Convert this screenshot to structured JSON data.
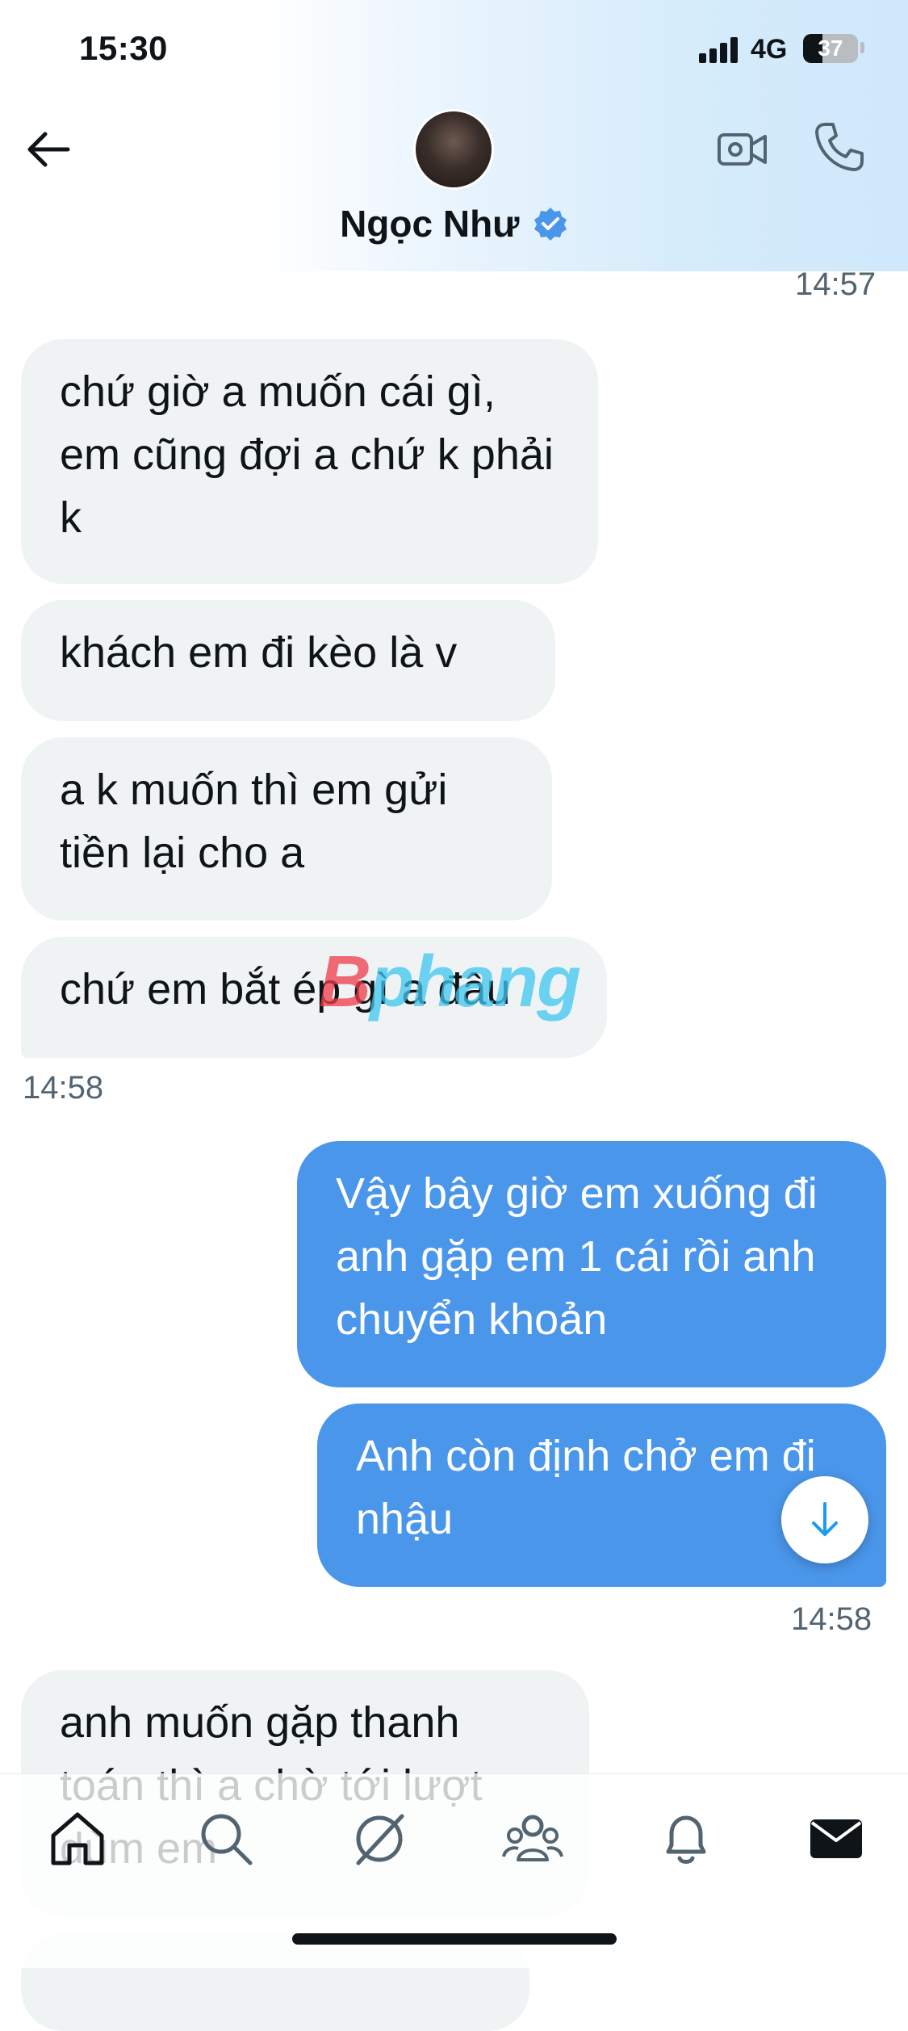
{
  "status_bar": {
    "time": "15:30",
    "network": "4G",
    "battery": "37"
  },
  "header": {
    "contact_name": "Ngọc Như",
    "back_icon": "arrow-left-icon",
    "verified_icon": "verified-badge-icon",
    "video_icon": "video-call-icon",
    "phone_icon": "phone-call-icon"
  },
  "messages": {
    "ts_1": "14:57",
    "in_1": "chứ giờ a muốn cái gì, em cũng đợi a chứ k phải k",
    "in_2": "khách em đi kèo là v",
    "in_3": "a k muốn thì em gửi tiền lại cho a",
    "in_4": "chứ em bắt ép gì a đâu",
    "ts_2": "14:58",
    "out_1": "Vậy bây giờ em xuống đi anh gặp em 1 cái rồi anh chuyển khoản",
    "out_2": "Anh còn định chở em đi nhậu",
    "ts_3": "14:58",
    "in_5": "anh muốn gặp thanh toán thì a chờ tới lượt dùm em"
  },
  "watermark": {
    "part1": "B",
    "part2": "phang"
  },
  "bottom_nav": {
    "items": [
      "home-icon",
      "search-icon",
      "grok-icon",
      "communities-icon",
      "notifications-icon",
      "messages-icon"
    ]
  },
  "colors": {
    "incoming_bubble": "#eff3f4",
    "outgoing_bubble": "#4a96ea",
    "verified": "#4a96ea"
  }
}
